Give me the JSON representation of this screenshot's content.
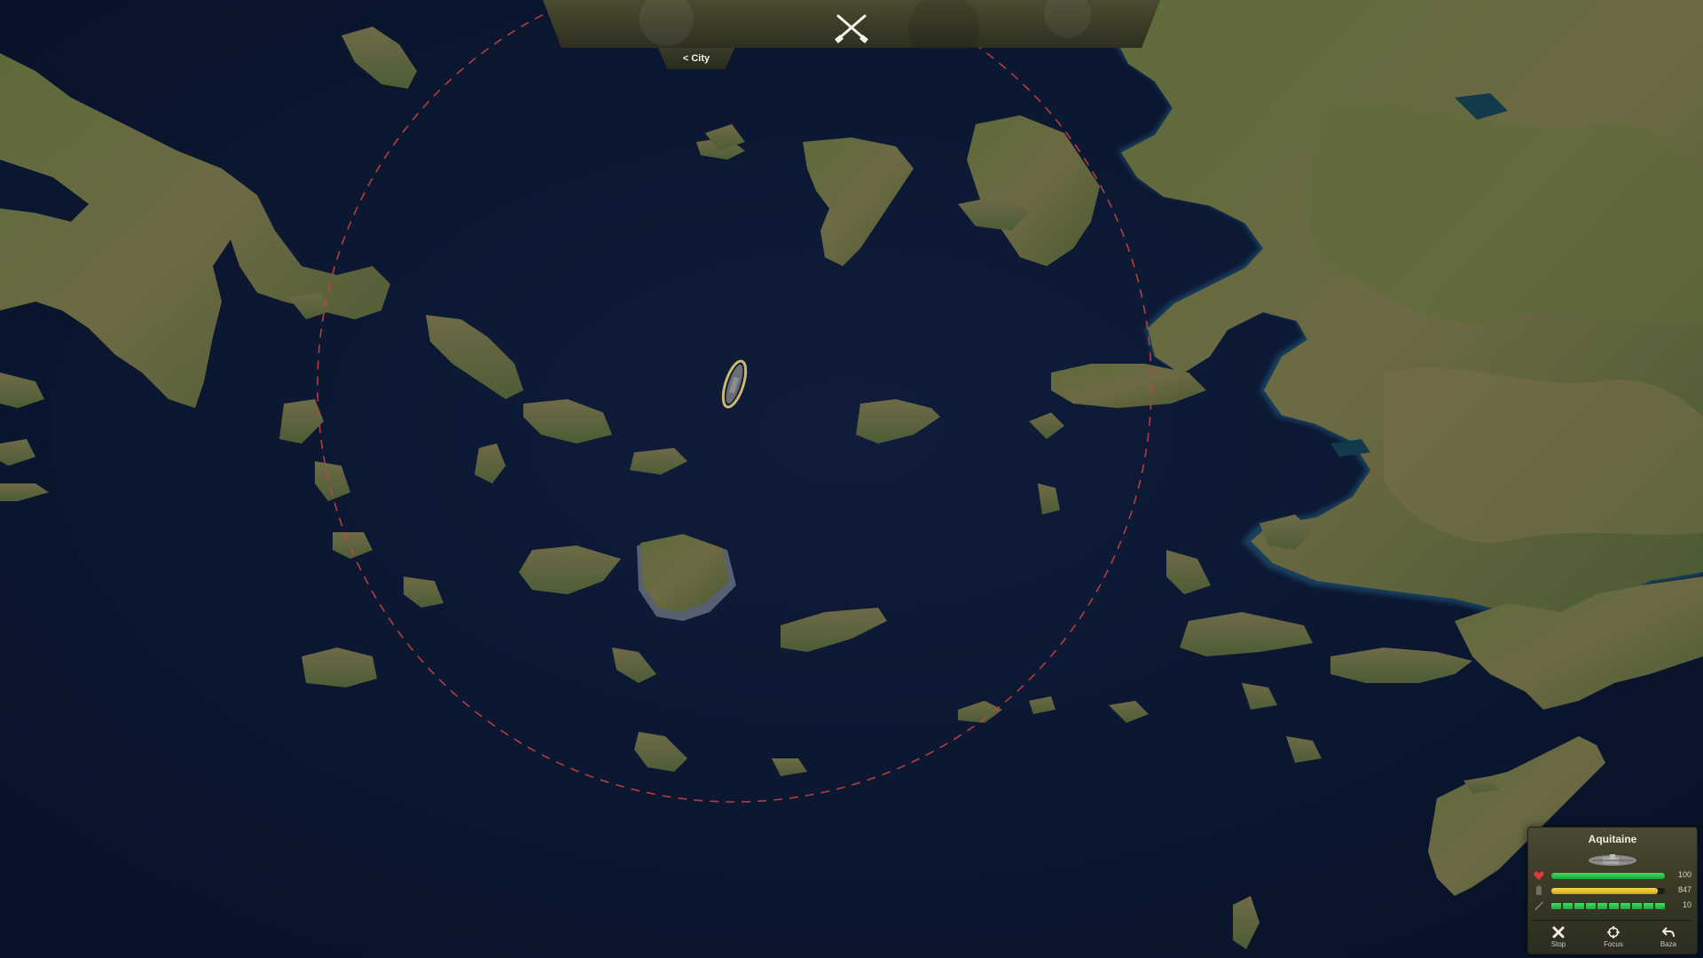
{
  "header": {
    "center_icon": "crossed-rifles-icon",
    "city_tab_label": "< City"
  },
  "map": {
    "range_circle_color": "#c8413f",
    "selected_unit_glow": "#f1d27a"
  },
  "unit_panel": {
    "name": "Aquitaine",
    "ship_icon": "frigate-ship-icon",
    "stats": [
      {
        "icon": "heart-icon",
        "color": "#e2383a",
        "value": "100",
        "fill": 1.0
      },
      {
        "icon": "fuel-icon",
        "color": "#6e6d60",
        "value": "847",
        "fill": 0.94
      },
      {
        "icon": "missile-icon",
        "color": "#d6d0c4",
        "value": "10",
        "fill": 1.0
      }
    ],
    "actions": [
      {
        "label": "Stop",
        "icon": "close-icon"
      },
      {
        "label": "Focus",
        "icon": "crosshair-icon"
      },
      {
        "label": "Baza",
        "icon": "return-arrow-icon"
      }
    ]
  }
}
